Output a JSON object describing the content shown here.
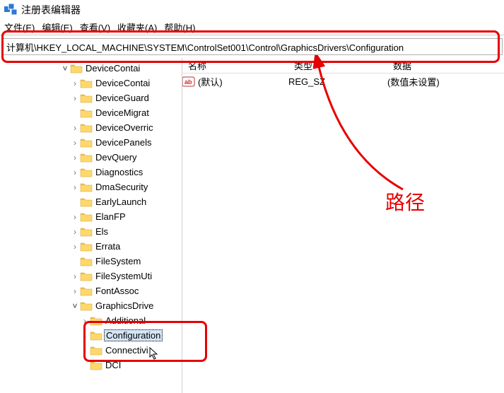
{
  "window": {
    "title": "注册表编辑器"
  },
  "menu": {
    "file": "文件(E)",
    "edit": "编辑(E)",
    "view": "查看(V)",
    "favorites": "收藏夹(A)",
    "help": "帮助(H)"
  },
  "address": {
    "path": "计算机\\HKEY_LOCAL_MACHINE\\SYSTEM\\ControlSet001\\Control\\GraphicsDrivers\\Configuration"
  },
  "columns": {
    "name": "名称",
    "type": "类型",
    "data": "数据"
  },
  "values": [
    {
      "name": "(默认)",
      "type": "REG_SZ",
      "data": "(数值未设置)"
    }
  ],
  "tree": {
    "items": [
      {
        "label": "DeviceContai",
        "expander": "˅",
        "indent": 99,
        "open": true
      },
      {
        "label": "DeviceContai",
        "expander": "›",
        "indent": 113
      },
      {
        "label": "DeviceGuard",
        "expander": "›",
        "indent": 113
      },
      {
        "label": "DeviceMigrat",
        "expander": "",
        "indent": 113,
        "noexp": true
      },
      {
        "label": "DeviceOverric",
        "expander": "›",
        "indent": 113
      },
      {
        "label": "DevicePanels",
        "expander": "›",
        "indent": 113
      },
      {
        "label": "DevQuery",
        "expander": "›",
        "indent": 113
      },
      {
        "label": "Diagnostics",
        "expander": "›",
        "indent": 113
      },
      {
        "label": "DmaSecurity",
        "expander": "›",
        "indent": 113
      },
      {
        "label": "EarlyLaunch",
        "expander": "",
        "indent": 113,
        "noexp": true
      },
      {
        "label": "ElanFP",
        "expander": "›",
        "indent": 113
      },
      {
        "label": "Els",
        "expander": "›",
        "indent": 113
      },
      {
        "label": "Errata",
        "expander": "›",
        "indent": 113
      },
      {
        "label": "FileSystem",
        "expander": "",
        "indent": 113,
        "noexp": true
      },
      {
        "label": "FileSystemUti",
        "expander": "›",
        "indent": 113
      },
      {
        "label": "FontAssoc",
        "expander": "›",
        "indent": 113
      },
      {
        "label": "GraphicsDrive",
        "expander": "˅",
        "indent": 113,
        "open": true
      },
      {
        "label": "Additional",
        "expander": "›",
        "indent": 127
      },
      {
        "label": "Configuration",
        "expander": "›",
        "indent": 127,
        "selected": true
      },
      {
        "label": "Connectivi",
        "expander": "›",
        "indent": 127
      },
      {
        "label": "DCI",
        "expander": "",
        "indent": 127,
        "noexp": true
      }
    ]
  },
  "annotation": {
    "label": "路径"
  }
}
